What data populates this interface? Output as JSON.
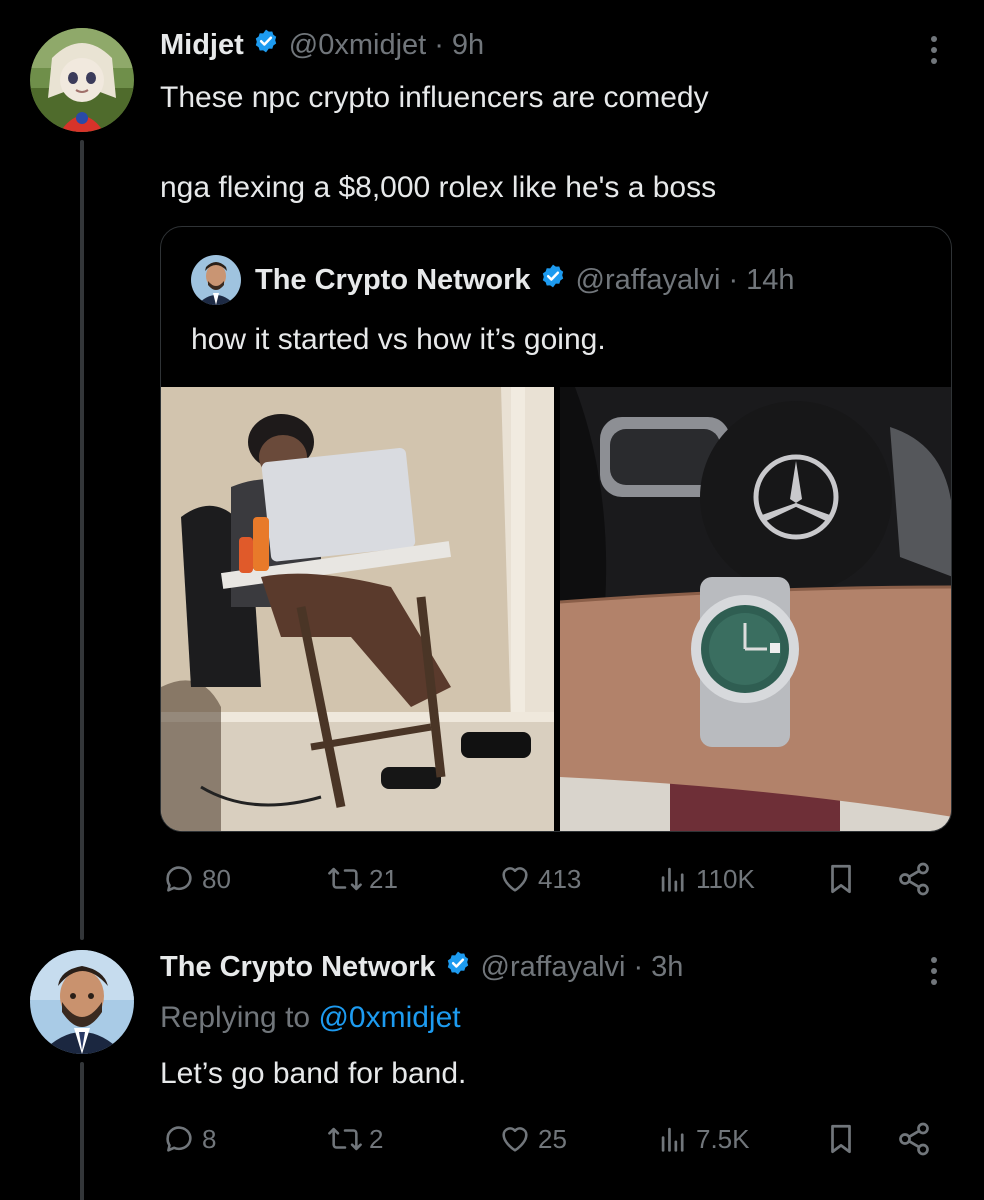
{
  "tweet": {
    "name": "Midjet",
    "handle": "@0xmidjet",
    "separator": "·",
    "time": "9h",
    "line1": "These npc crypto influencers are comedy",
    "line2": "nga flexing a $8,000 rolex like he's a boss",
    "quote": {
      "name": "The Crypto Network",
      "handle": "@raffayalvi",
      "separator": "·",
      "time": "14h",
      "text": "how it started vs how it’s going."
    },
    "stats": {
      "replies": "80",
      "reposts": "21",
      "likes": "413",
      "views": "110K"
    }
  },
  "reply": {
    "name": "The Crypto Network",
    "handle": "@raffayalvi",
    "separator": "·",
    "time": "3h",
    "replying_prefix": "Replying to",
    "replying_to": "@0xmidjet",
    "text": "Let’s go band for band.",
    "stats": {
      "replies": "8",
      "reposts": "2",
      "likes": "25",
      "views": "7.5K"
    }
  },
  "icons": {
    "verified": "verified-badge-icon",
    "more": "more-options-icon",
    "reply": "reply-icon",
    "repost": "repost-icon",
    "like": "like-icon",
    "views": "views-icon",
    "bookmark": "bookmark-icon",
    "share": "share-icon"
  },
  "colors": {
    "background": "#000000",
    "text": "#e7e9ea",
    "muted": "#71767b",
    "accent": "#1d9bf0",
    "border": "#2f3336"
  }
}
